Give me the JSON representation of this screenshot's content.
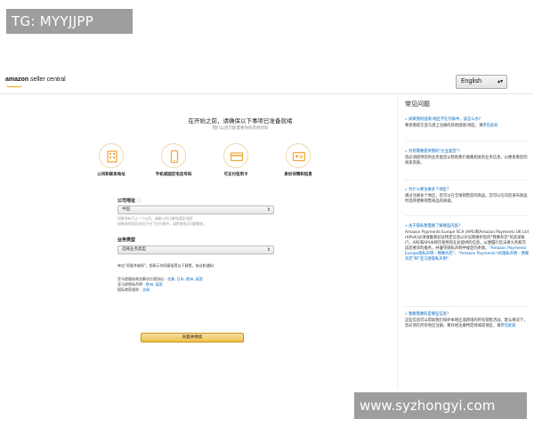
{
  "watermarks": {
    "top": "TG: MYYJJPP",
    "bottom": "www.syzhongyi.com"
  },
  "header": {
    "logo_brand": "amazon",
    "logo_suffix": " seller central",
    "language": "English",
    "language_chevron": "▴▾"
  },
  "main": {
    "title": "在开始之前，请确保以下事项已准备就绪",
    "subtitle": "我们以后可能需要你的其他资料",
    "items": [
      {
        "icon": "building-icon",
        "label": "公司和联系地址"
      },
      {
        "icon": "phone-icon",
        "label": "手机或固定电话号码"
      },
      {
        "icon": "credit-card-icon",
        "label": "可支付信用卡"
      },
      {
        "icon": "id-card-icon",
        "label": "身份详情和信息"
      }
    ],
    "country_label": "公司地址",
    "country_info": "ⓘ",
    "country_value": "中国",
    "country_hint1": "如果你有不止一个公司，请输入你注册的国家/地区",
    "country_hint2": "如果你的国家/地区不在下拉列表中，请检查常见问题解答。",
    "business_label": "业务类型",
    "business_value": "选择业务类型",
    "agree_text": "单击\"同意并继续\"，即表示你同意接受以下政策、协议和通知:",
    "policy_prefix": "亚马逊服务商业解决方案协议 - ",
    "policy_links": "北美, 日本, 欧洲, 英国",
    "privacy_prefix": "亚马逊隐私声明 - ",
    "privacy_links": "欧洲, 英国",
    "anti_prefix": "国际商家规则 - ",
    "anti_links": "全球",
    "submit": "同意并继续",
    "chevron": "⇕"
  },
  "faq": {
    "title": "常见问题",
    "items": [
      {
        "q": "» 如果我的国家/地区不在列表中，该怎么办?",
        "a": "要查看提交亚马逊上注册的其他国家/地区，请",
        "a_link": "参见此处"
      },
      {
        "q": "» 为何需要提供我的\"企业类型\"?",
        "a": "您必须提供您的业务类型以帮助我们收集相关的业务信息，以便查看您的商家资质。",
        "a_link": ""
      },
      {
        "q": "» 为什么要注册多个地区?",
        "a": "通过注册多个地区，您可以在全球销售您的商品。您可以在日后发布商品时选择想要销售商品的商城。",
        "a_link": ""
      },
      {
        "q": "» 关于隐私我需要了解哪些内容?",
        "a": "Amazon Payments Europe SCA (APE)和Amazon Payments UK Ltd (APUK)必须收集和验证特定信息以开设和维护您的\"我要开店\"的卖家账户。APE和APUK将仅使用您在此提供的信息，以便履行其法律义务和完成您要求的服务，并遵守隐私声明中规定的条款。",
        "a_link": "\"Amazon Payments Europe隐私声明 - 我要开店\"、\"Amazon Payments UK隐私声明 - 我要开店\"和\"亚马逊隐私声明\""
      },
      {
        "q": "» 我要需要的是哪些信息?",
        "a": "这些信息可以帮助我们保护本地区或跨境的所有销售活动。默认情况下，您必须在所有地区注册。要开始注册特定商城或地区，请",
        "a_link": "参见此处"
      }
    ]
  }
}
